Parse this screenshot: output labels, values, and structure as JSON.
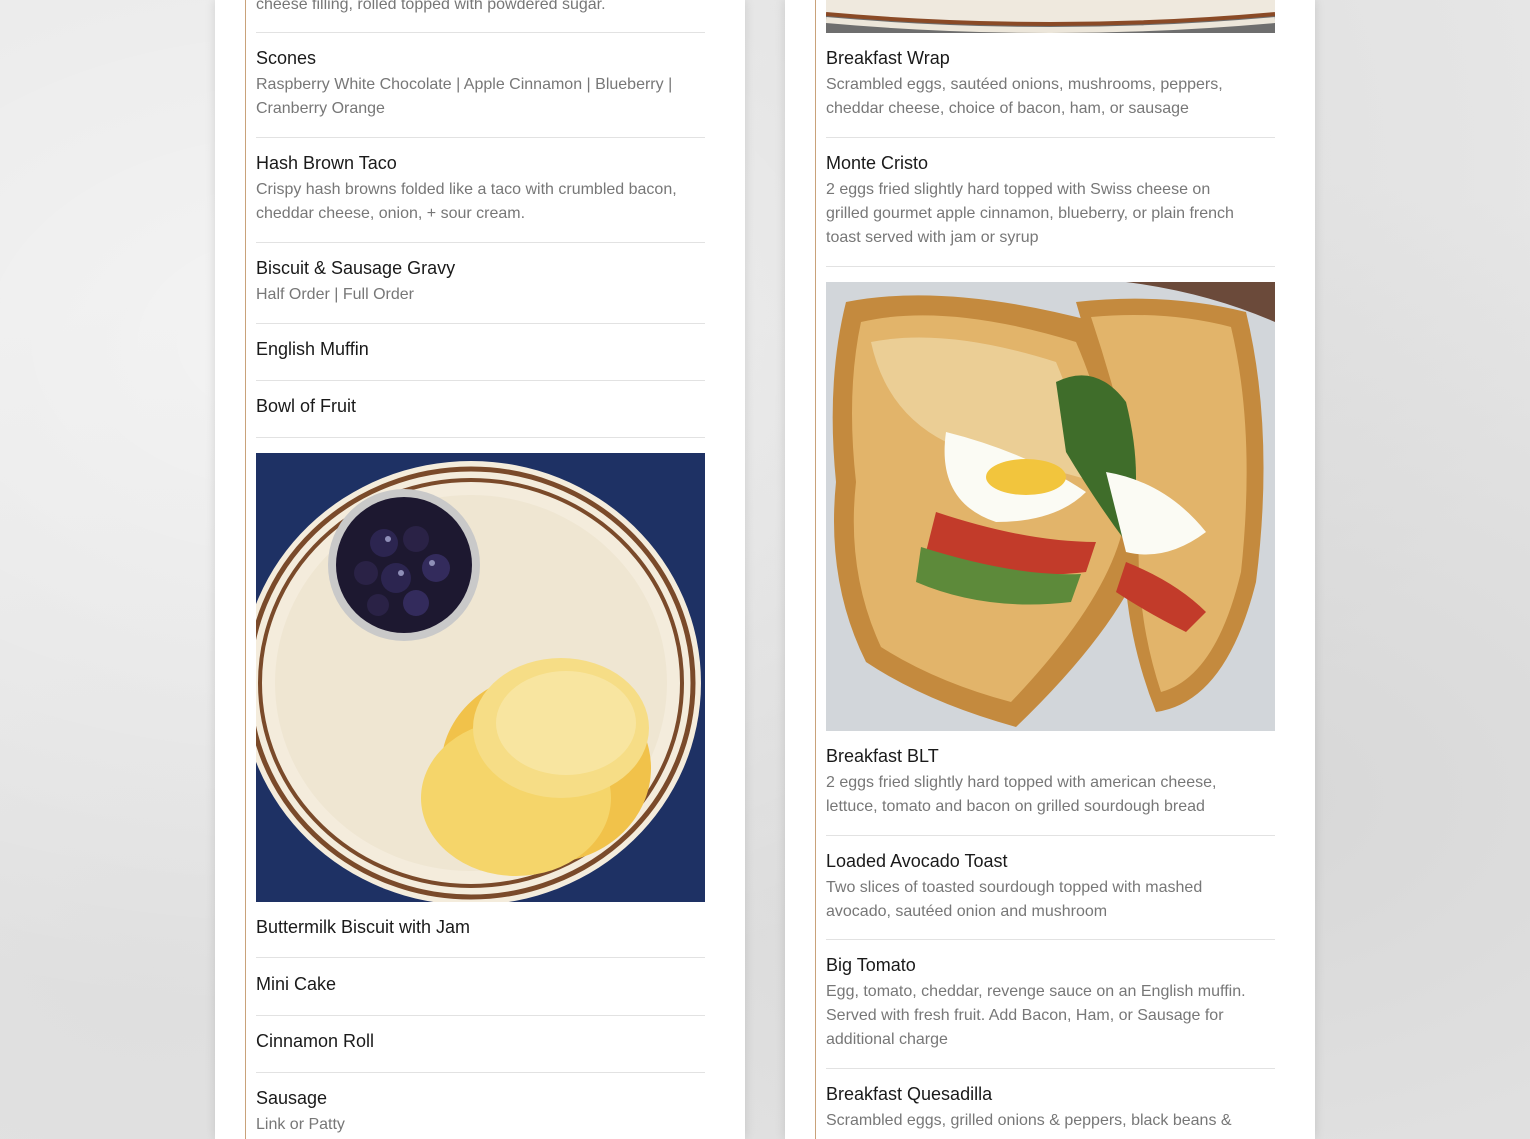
{
  "left_column": {
    "top_partial_text": "cheese filling, rolled topped with powdered sugar.",
    "items_a": [
      {
        "name": "Scones",
        "desc": "Raspberry White Chocolate | Apple Cinnamon | Blueberry | Cranberry Orange"
      },
      {
        "name": "Hash Brown Taco",
        "desc": "Crispy hash browns folded like a taco with crumbled bacon, cheddar cheese, onion, + sour cream."
      },
      {
        "name": "Biscuit & Sausage Gravy",
        "desc": "Half Order | Full Order"
      },
      {
        "name": "English Muffin",
        "desc": ""
      },
      {
        "name": "Bowl of Fruit",
        "desc": ""
      }
    ],
    "photo_icon": "biscuit-with-jam-photo",
    "items_b": [
      {
        "name": "Buttermilk Biscuit with Jam",
        "desc": ""
      },
      {
        "name": "Mini Cake",
        "desc": ""
      },
      {
        "name": "Cinnamon Roll",
        "desc": ""
      },
      {
        "name": "Sausage",
        "desc": "Link or Patty"
      }
    ]
  },
  "right_column": {
    "top_photo_icon": "plate-photo",
    "items_a": [
      {
        "name": "Breakfast Wrap",
        "desc": "Scrambled eggs, sautéed onions, mushrooms, peppers, cheddar cheese, choice of bacon, ham, or sausage"
      },
      {
        "name": "Monte Cristo",
        "desc": "2 eggs fried slightly hard topped with Swiss cheese on grilled gourmet apple cinnamon, blueberry, or plain french toast served with jam or syrup"
      }
    ],
    "photo_icon": "breakfast-blt-sandwich-photo",
    "items_b": [
      {
        "name": "Breakfast BLT",
        "desc": "2 eggs fried slightly hard topped with american cheese, lettuce, tomato and bacon on grilled sourdough bread"
      },
      {
        "name": "Loaded Avocado Toast",
        "desc": "Two slices of toasted sourdough topped with mashed avocado, sautéed onion and mushroom"
      },
      {
        "name": "Big Tomato",
        "desc": "Egg, tomato, cheddar, revenge sauce on an English muffin. Served with fresh fruit. Add Bacon, Ham, or Sausage for additional charge"
      },
      {
        "name": "Breakfast Quesadilla",
        "desc": "Scrambled eggs, grilled onions & peppers, black beans &"
      }
    ]
  },
  "colors": {
    "accent_border": "#c9a27a",
    "item_name": "#1a1a1a",
    "item_desc": "#777777",
    "divider": "#e2e2e2",
    "panel": "#ffffff",
    "background": "#e6e6e6"
  }
}
